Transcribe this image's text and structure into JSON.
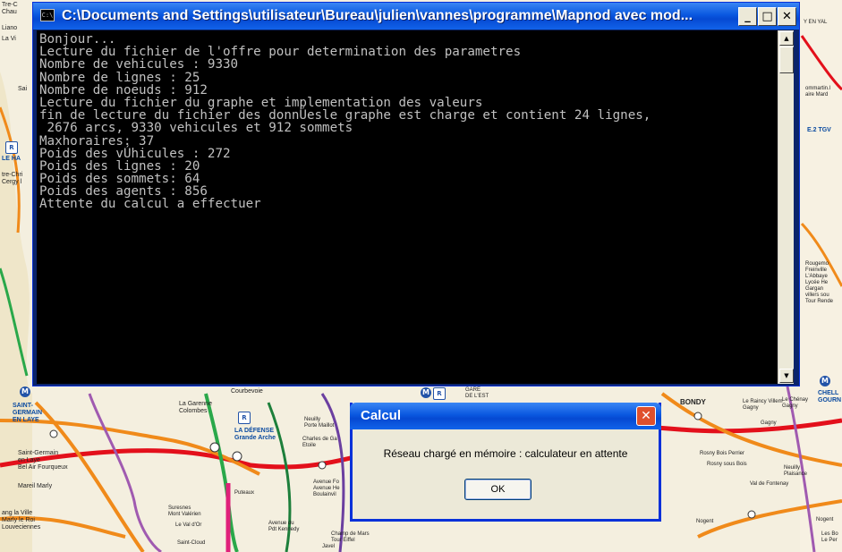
{
  "console": {
    "title": "C:\\Documents and Settings\\utilisateur\\Bureau\\julien\\vannes\\programme\\Mapnod avec mod...",
    "system_icon_text": "C:\\",
    "minimize_glyph": "_",
    "maximize_glyph": "□",
    "close_glyph": "✕",
    "lines": [
      "Bonjour...",
      "Lecture du fichier de l'offre pour determination des parametres",
      "Nombre de vehicules : 9330",
      "Nombre de lignes : 25",
      "Nombre de noeuds : 912",
      "Lecture du fichier du graphe et implementation des valeurs",
      "fin de lecture du fichier des donnÚesle graphe est charge et contient 24 lignes,",
      " 2676 arcs, 9330 vehicules et 912 sommets",
      "Maxhoraires: 37",
      "Poids des vÚhicules : 272",
      "Poids des lignes : 20",
      "Poids des sommets: 64",
      "Poids des agents : 856",
      "Attente du calcul a effectuer"
    ],
    "scroll_up_glyph": "▲",
    "scroll_down_glyph": "▼"
  },
  "dialog": {
    "title": "Calcul",
    "close_glyph": "✕",
    "message": "Réseau chargé en mémoire : calculateur en attente",
    "ok_label": "OK"
  },
  "map": {
    "labels": {
      "l1": "Tre-C\nChau",
      "l2": "Liano",
      "l3": "La Vi",
      "l4": "Sai",
      "l5": "LE HA",
      "l6": "tre-Chri\nCergy l",
      "l7": "SAINT-\nGERMAIN\nEN LAYE",
      "l8": "Saint-Germain\nen Laye\nBel Air Fourqueux",
      "l9": "Mareil Marly",
      "l10": "ang la Ville\nMarly le Roi\nLouveciennes",
      "l11": "Courbevoie",
      "l12": "La Garenne\nColombes",
      "l13": "LA DÉFENSE\nGrande Arche",
      "l14": "Neuilly\nPorte Maillot",
      "l15": "Charles de Ga\nEtoile",
      "l16": "Puteaux",
      "l17": "Suresnes\nMont Valérien",
      "l18": "Le Val d'Or",
      "l19": "Saint-Cloud",
      "l20": "Avenue Fo\nAvenue He\nBoulainvil",
      "l21": "Avenue du\nPdt Kennedy",
      "l22": "Champ de Mars\nTour Eiffel",
      "l23": "Javel",
      "l24": "GARE\nDE L'EST",
      "l25": "BONDY",
      "l26": "Rosny Bois Perrier",
      "l27": "Rosny sous Bois",
      "l28": "Nogent",
      "l29": "Les Bo\nLe Per",
      "l30": "Rougemo\nFreinville\nL'Abbaye\nLycée He\nGargan\nvillers sou\nTour Rende",
      "l31": "ommartin.l\naire Mard",
      "l32": "E.2 TGV",
      "l33": "Y EN YAL",
      "l34": "CHELL\nGOURN",
      "l35": "Le Raincy Villem\nGagny",
      "l36": "Gagny",
      "l37": "Le Chénay\nGagny",
      "l38": "Neuilly\nPlaisance",
      "l39": "Val de Fontenay",
      "l40": "Nogent"
    }
  }
}
